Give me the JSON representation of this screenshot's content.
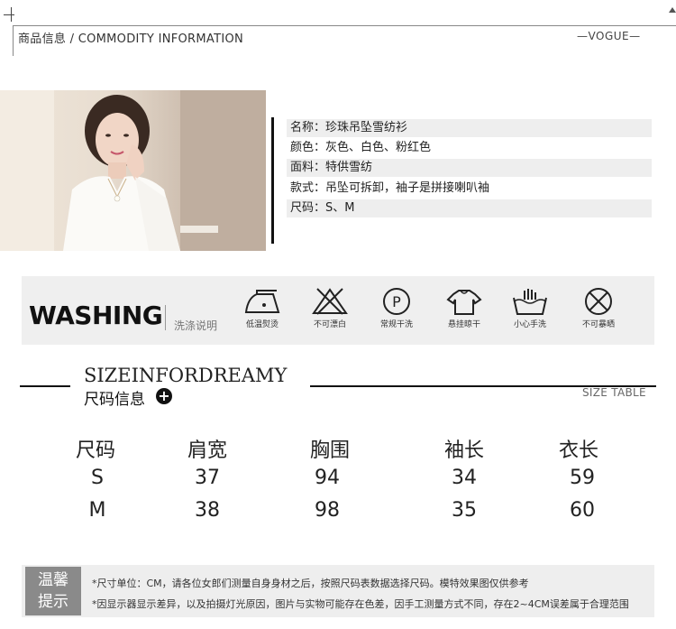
{
  "header": {
    "title": "商品信息 / COMMODITY INFORMATION",
    "right": "—VOGUE—"
  },
  "product": {
    "rows": [
      {
        "text": "名称：珍珠吊坠雪纺衫"
      },
      {
        "text": "颜色：灰色、白色、粉红色"
      },
      {
        "text": "面料：特供雪纺"
      },
      {
        "text": "款式：吊坠可拆卸，袖子是拼接喇叭袖"
      },
      {
        "text": "尺码：S、M"
      }
    ]
  },
  "washing": {
    "title": "WASHING",
    "subtitle": "洗涤说明",
    "items": [
      {
        "label": "低温熨烫",
        "icon": "iron-low-temp-icon"
      },
      {
        "label": "不可漂白",
        "icon": "no-bleach-icon"
      },
      {
        "label": "常规干洗",
        "icon": "dry-clean-icon"
      },
      {
        "label": "悬挂晾干",
        "icon": "hang-dry-icon"
      },
      {
        "label": "小心手洗",
        "icon": "hand-wash-icon"
      },
      {
        "label": "不可暴晒",
        "icon": "no-sun-icon"
      }
    ]
  },
  "size": {
    "title_en": "SIZEINFORDREAMY",
    "title_cn": "尺码信息",
    "plus": "+",
    "table_label": "SIZE TABLE",
    "headers": [
      "尺码",
      "肩宽",
      "胸围",
      "袖长",
      "衣长"
    ],
    "rows": [
      [
        "S",
        "37",
        "94",
        "34",
        "59"
      ],
      [
        "M",
        "38",
        "98",
        "35",
        "60"
      ]
    ]
  },
  "tips": {
    "label_line1": "温馨",
    "label_line2": "提示",
    "lines": [
      "*尺寸单位：CM，请各位女郎们测量自身身材之后，按照尺码表数据选择尺码。模特效果图仅供参考",
      "*因显示器显示差异，以及拍摄灯光原因，图片与实物可能存在色差，因手工测量方式不同，存在2~4CM误差属于合理范围"
    ]
  }
}
